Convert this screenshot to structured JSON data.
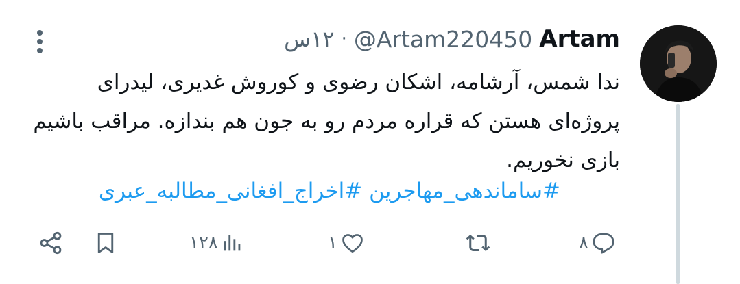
{
  "tweet": {
    "display_name": "Artam",
    "handle": "@Artam220450",
    "separator": "·",
    "time": "۱۲س",
    "text": "ندا شمس، آرشامه، اشکان رضوی و کوروش غدیری، لیدرای پروژه‌ای هستن که قراره مردم رو به جون هم بندازه. مراقب باشیم بازی نخوریم.",
    "hashtags": "#ساماندهی_مهاجرین #اخراج_افغانی_مطالبه_عبری"
  },
  "actions": {
    "reply_count": "۸",
    "retweet_count": "",
    "like_count": "۱",
    "views_count": "۱۲۸"
  },
  "icons": {
    "more": "more-vertical-icon",
    "reply": "reply-icon",
    "retweet": "retweet-icon",
    "like": "heart-icon",
    "views": "views-icon",
    "bookmark": "bookmark-icon",
    "share": "share-icon"
  },
  "colors": {
    "text": "#0f1419",
    "secondary": "#536471",
    "link": "#1d9bf0",
    "thread_line": "#cfd9de"
  }
}
